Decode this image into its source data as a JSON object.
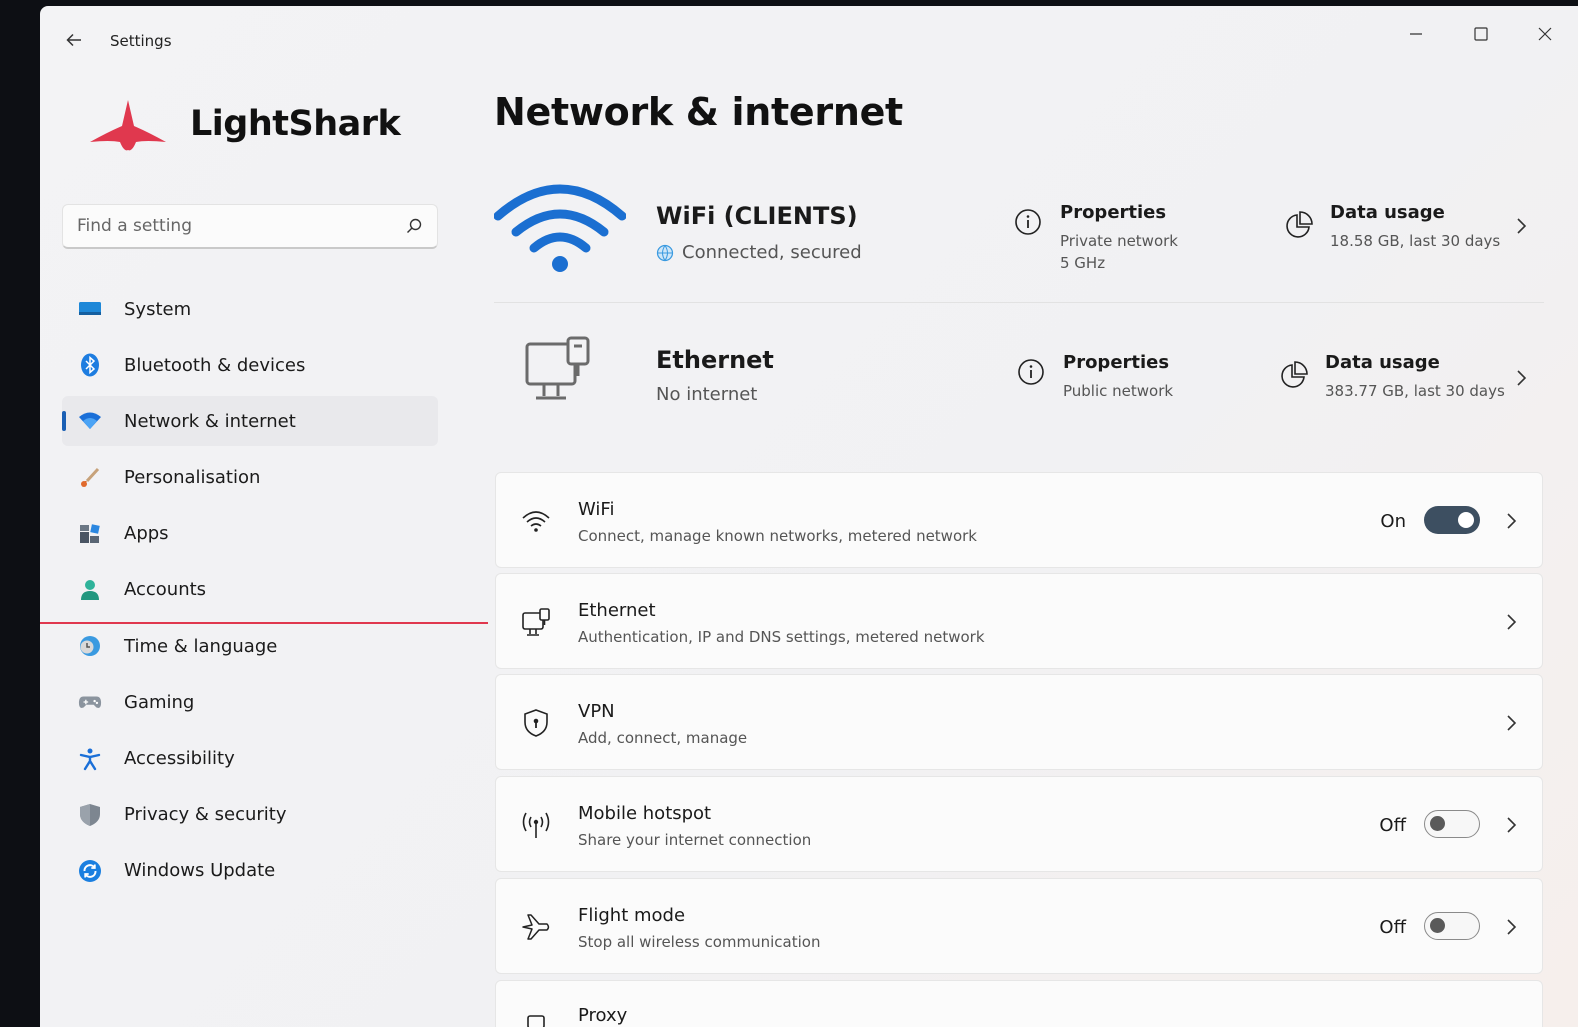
{
  "window": {
    "title": "Settings"
  },
  "brand": {
    "name": "LightShark",
    "accent": "#e0384e"
  },
  "search": {
    "placeholder": "Find a setting"
  },
  "sidebar": {
    "items": [
      {
        "label": "System",
        "icon": "system-icon"
      },
      {
        "label": "Bluetooth & devices",
        "icon": "bluetooth-icon"
      },
      {
        "label": "Network & internet",
        "icon": "wifi-icon",
        "active": true
      },
      {
        "label": "Personalisation",
        "icon": "brush-icon"
      },
      {
        "label": "Apps",
        "icon": "apps-icon"
      },
      {
        "label": "Accounts",
        "icon": "person-icon"
      },
      {
        "label": "Time & language",
        "icon": "clock-globe-icon"
      },
      {
        "label": "Gaming",
        "icon": "gamepad-icon"
      },
      {
        "label": "Accessibility",
        "icon": "accessibility-icon"
      },
      {
        "label": "Privacy & security",
        "icon": "shield-icon"
      },
      {
        "label": "Windows Update",
        "icon": "update-icon"
      }
    ]
  },
  "main": {
    "title": "Network & internet",
    "connections": [
      {
        "name": "WiFi (CLIENTS)",
        "status": "Connected, secured",
        "properties": {
          "title": "Properties",
          "line1": "Private network",
          "line2": "5 GHz"
        },
        "usage": {
          "title": "Data usage",
          "detail": "18.58 GB, last 30 days"
        }
      },
      {
        "name": "Ethernet",
        "status": "No internet",
        "properties": {
          "title": "Properties",
          "line1": "Public network"
        },
        "usage": {
          "title": "Data usage",
          "detail": "383.77 GB, last 30 days"
        }
      }
    ],
    "cards": [
      {
        "title": "WiFi",
        "subtitle": "Connect, manage known networks, metered network",
        "icon": "wifi-icon",
        "toggle": "On"
      },
      {
        "title": "Ethernet",
        "subtitle": "Authentication, IP and DNS settings, metered network",
        "icon": "ethernet-icon"
      },
      {
        "title": "VPN",
        "subtitle": "Add, connect, manage",
        "icon": "vpn-shield-icon"
      },
      {
        "title": "Mobile hotspot",
        "subtitle": "Share your internet connection",
        "icon": "hotspot-icon",
        "toggle": "Off"
      },
      {
        "title": "Flight mode",
        "subtitle": "Stop all wireless communication",
        "icon": "airplane-icon",
        "toggle": "Off"
      },
      {
        "title": "Proxy",
        "icon": "proxy-icon"
      }
    ]
  },
  "colors": {
    "accent_blue": "#1a5fb4",
    "wifi_blue": "#1b6fd1"
  }
}
